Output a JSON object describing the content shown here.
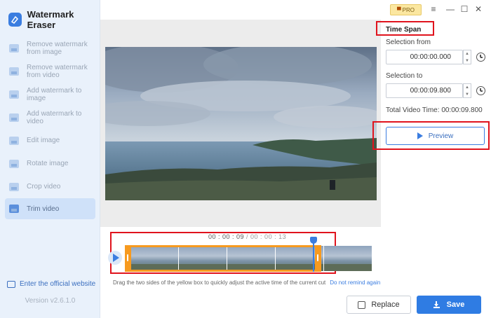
{
  "app": {
    "title": "Watermark Eraser",
    "version": "Version v2.6.1.0",
    "official_link": "Enter the official website",
    "accent_color": "#2f7ce3"
  },
  "sidebar": {
    "items": [
      {
        "label": "Remove watermark from image",
        "icon": "image-eraser-icon",
        "active": false
      },
      {
        "label": "Remove watermark from video",
        "icon": "video-eraser-icon",
        "active": false
      },
      {
        "label": "Add watermark to image",
        "icon": "add-image-watermark-icon",
        "active": false
      },
      {
        "label": "Add watermark to video",
        "icon": "add-video-watermark-icon",
        "active": false
      },
      {
        "label": "Edit image",
        "icon": "edit-image-icon",
        "active": false
      },
      {
        "label": "Rotate image",
        "icon": "rotate-image-icon",
        "active": false
      },
      {
        "label": "Crop video",
        "icon": "crop-video-icon",
        "active": false
      },
      {
        "label": "Trim video",
        "icon": "trim-video-icon",
        "active": true
      }
    ]
  },
  "topbar": {
    "pro_label": "PRO",
    "pro_icon": "cart-icon",
    "menu_icon": "≡",
    "minimize_icon": "—",
    "maximize_icon": "☐",
    "close_icon": "✕"
  },
  "panel": {
    "time_span_label": "Time Span",
    "selection_from_label": "Selection from",
    "selection_from_value": "00:00:00.000",
    "selection_to_label": "Selection to",
    "selection_to_value": "00:00:09.800",
    "total_video_time_label": "Total Video Time:",
    "total_video_time_value": "00:00:09.800",
    "preview_label": "Preview"
  },
  "timeline": {
    "current_time": "00 : 00 : 09",
    "total_time": " / 00 : 00 : 13",
    "hint": "Drag the two sides of the yellow box to quickly adjust the active time of the current cut",
    "dont_remind": "Do not remind again"
  },
  "actions": {
    "replace_label": "Replace",
    "save_label": "Save"
  }
}
